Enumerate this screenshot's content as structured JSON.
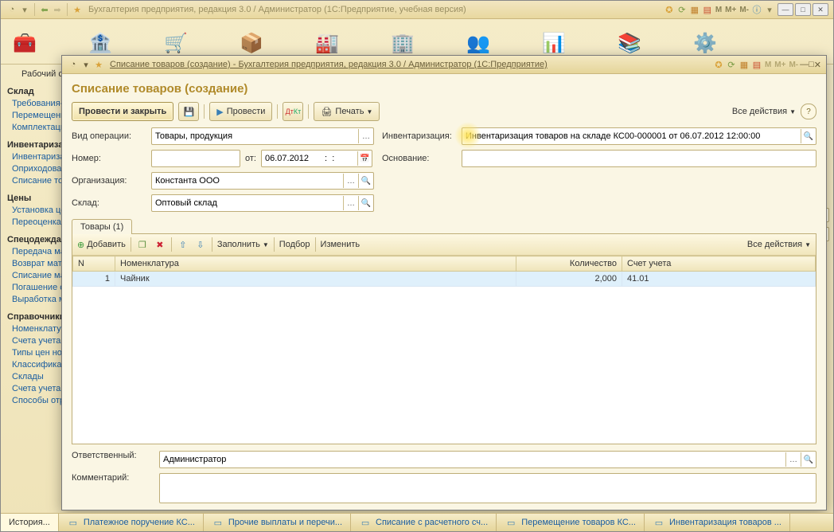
{
  "main_title": "Бухгалтерия предприятия, редакция 3.0 / Администратор  (1С:Предприятие, учебная версия)",
  "sidebar": {
    "desktop": "Рабочий стол",
    "groups": [
      {
        "title": "Склад",
        "items": [
          "Требования-накладные",
          "Перемещение товаров",
          "Комплектация номенклатуры"
        ]
      },
      {
        "title": "Инвентаризация",
        "items": [
          "Инвентаризация товаров",
          "Оприходование товаров",
          "Списание товаров"
        ]
      },
      {
        "title": "Цены",
        "items": [
          "Установка цен номенклатуры",
          "Переоценка товаров в рознице"
        ]
      },
      {
        "title": "Спецодежда",
        "items": [
          "Передача материалов в эксплуатацию",
          "Возврат материалов из эксплуатации",
          "Списание материалов из эксплуатации",
          "Погашение стоимости",
          "Выработка материалов"
        ]
      },
      {
        "title": "Справочники",
        "items": [
          "Номенклатура",
          "Счета учета номенклатуры",
          "Типы цен номенклатуры",
          "Классификатор единиц измерения",
          "Склады",
          "Счета учета в НТТ",
          "Способы отражения расходов"
        ]
      }
    ]
  },
  "inner_title": "Списание товаров (создание) - Бухгалтерия предприятия, редакция 3.0 / Администратор  (1С:Предприятие)",
  "form_title": "Списание товаров (создание)",
  "cmd": {
    "post_close": "Провести и закрыть",
    "post": "Провести",
    "print": "Печать",
    "all_actions": "Все действия"
  },
  "fields": {
    "op_label": "Вид операции:",
    "op_value": "Товары, продукция",
    "num_label": "Номер:",
    "num_value": "",
    "date_label": "от:",
    "date_value": "06.07.2012",
    "time_value": " :  : ",
    "org_label": "Организация:",
    "org_value": "Константа ООО",
    "wh_label": "Склад:",
    "wh_value": "Оптовый склад",
    "inv_label": "Инвентаризация:",
    "inv_value": "Инвентаризация товаров на складе КС00-000001 от 06.07.2012 12:00:00",
    "basis_label": "Основание:",
    "basis_value": "",
    "resp_label": "Ответственный:",
    "resp_value": "Администратор",
    "comment_label": "Комментарий:",
    "comment_value": ""
  },
  "tab_label": "Товары (1)",
  "tab_toolbar": {
    "add": "Добавить",
    "fill": "Заполнить",
    "pick": "Подбор",
    "change": "Изменить",
    "all_actions": "Все действия"
  },
  "grid": {
    "cols": {
      "n": "N",
      "nomen": "Номенклатура",
      "qty": "Количество",
      "acct": "Счет учета"
    },
    "rows": [
      {
        "n": "1",
        "nomen": "Чайник",
        "qty": "2,000",
        "acct": "41.01"
      }
    ]
  },
  "taskbar": {
    "history": "История...",
    "items": [
      "Платежное поручение КС...",
      "Прочие выплаты и перечи...",
      "Списание с расчетного сч...",
      "Перемещение товаров КС...",
      "Инвентаризация товаров ..."
    ]
  },
  "m_labels": [
    "M",
    "M+",
    "M-"
  ]
}
